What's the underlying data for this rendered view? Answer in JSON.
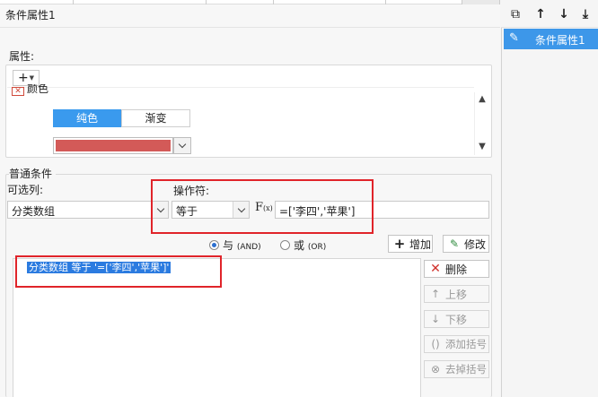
{
  "window": {
    "title": "条件属性1"
  },
  "properties": {
    "label": "属性:",
    "add_symbol": "+",
    "list_first_item": "颜色",
    "tab_solid": "纯色",
    "tab_gradient": "渐变",
    "selected_color": "#d35a58"
  },
  "conditions": {
    "section_label": "普通条件",
    "column_label": "可选列:",
    "column_value": "分类数组",
    "operator_label": "操作符:",
    "operator_value": "等于",
    "fx_label": "F",
    "fx_sub": "(x)",
    "value_input": "=['李四','苹果']",
    "radio_and_label": "与",
    "radio_and_sub": "(AND)",
    "radio_or_label": "或",
    "radio_or_sub": "(OR)",
    "add_button": "增加",
    "modify_button": "修改",
    "list_items": [
      "分类数组  等于  '=['李四','苹果']'"
    ],
    "delete_button": "删除",
    "move_up_button": "上移",
    "move_down_button": "下移",
    "add_bracket_button": "添加括号",
    "remove_bracket_button": "去掉括号"
  },
  "right_panel": {
    "items": [
      "条件属性1"
    ]
  },
  "colors": {
    "accent": "#3a9aee",
    "highlight_box": "#e0242a"
  }
}
